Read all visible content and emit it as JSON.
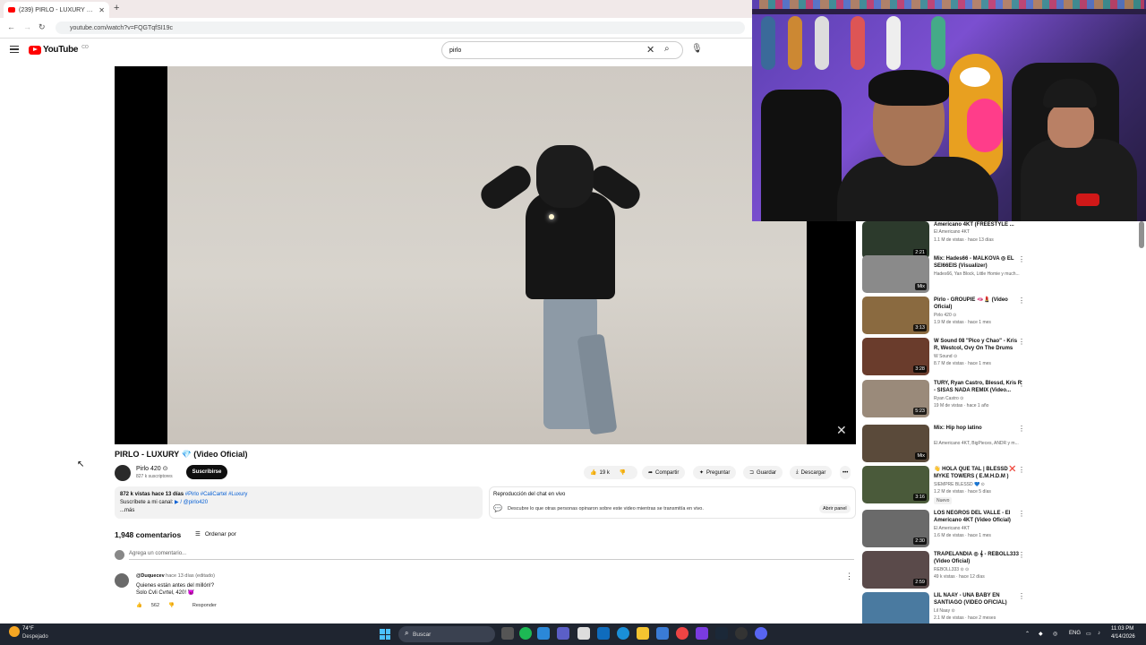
{
  "browser": {
    "tab_title": "(239) PIRLO - LUXURY 💎 (Vide",
    "tab_close": "✕",
    "new_tab": "+",
    "url": "youtube.com/watch?v=FQGTqfSI19c"
  },
  "header": {
    "logo_text": "YouTube",
    "logo_suffix": "CO",
    "search_value": "pirlo",
    "search_clear": "✕",
    "search_icon": "⌕",
    "mic_icon": "🎙"
  },
  "video": {
    "title": "PIRLO - LUXURY 💎 (Video Oficial)",
    "channel": "Pirlo 420 ⊙",
    "subs": "827 k suscriptores",
    "subscribe": "Suscribirse",
    "likes": "19 k",
    "share": "Compartir",
    "ask": "Preguntar",
    "save": "Guardar",
    "download": "Descargar",
    "more": "•••"
  },
  "description": {
    "views": "872 k vistas  hace 13 días",
    "tags": " #Pirlo #CaliCartel #Luxury",
    "line2": "Suscríbete a mi canal: ",
    "link": "▶ / @pirlo420",
    "more": "...más"
  },
  "chat": {
    "title": "Reproducción del chat en vivo",
    "desc": "Descubre lo que otras personas opinaron sobre este video mientras se transmitía en vivo.",
    "open": "Abrir panel"
  },
  "comments": {
    "count": "1,948 comentarios",
    "sort": "Ordenar por",
    "placeholder": "Agrega un comentario...",
    "first": {
      "user": "@Duquecev",
      "time": " hace 13 días (editado)",
      "line1": "Quienes están antes del millón!?",
      "line2": "Solo Cvli Cvrtel, 420! 😈",
      "likes": "562",
      "reply": "Responder"
    }
  },
  "sidebar": [
    {
      "title": "Americano 4KT (FREESTYLE ...",
      "channel": "El Americano 4KT",
      "meta": "1.1 M de vistas · hace 13 días",
      "duration": "2:21",
      "thumb": "#2c3a2c"
    },
    {
      "title": "Mix: Hades66 - MALKOVA ◎ EL SEI66EIS (Visualizer)",
      "channel": "Hades66, Yan Block, Little Homie y much...",
      "meta": "",
      "duration": "Mix",
      "thumb": "#8a8a8a"
    },
    {
      "title": "Pirlo - GROUPIE 🫦💄 (Video Oficial)",
      "channel": "Pirlo 420 ⊙",
      "meta": "1.9 M de vistas · hace 1 mes",
      "duration": "3:13",
      "thumb": "#8a6a40"
    },
    {
      "title": "W Sound 08 \"Pico y Chao\" - Kris R, Westcol, Ovy On The Drums",
      "channel": "W Sound ⊙",
      "meta": "8.7 M de vistas · hace 1 mes",
      "duration": "3:28",
      "thumb": "#6a3c2c"
    },
    {
      "title": "TURY, Ryan Castro, Blessd, Kris R - SISAS NADA REMIX (Video...",
      "channel": "Ryan Castro ⊙",
      "meta": "19 M de vistas · hace 1 año",
      "duration": "5:23",
      "thumb": "#9a8a7a"
    },
    {
      "title": "Mix: Hip hop latino",
      "channel": "El Americano 4KT, BigPieces, ANDR y m...",
      "meta": "",
      "duration": "Mix",
      "thumb": "#5a4a3a"
    },
    {
      "title": "👋 HOLA QUE TAL | BLESSD ❌ MYKE TOWERS ( E.M.H.D.M )",
      "channel": "SIEMPRE BLESSD 💙 ⊙",
      "meta": "1.2 M de vistas · hace 5 días",
      "duration": "3:16",
      "thumb": "#4a5a3a",
      "badge": "Nuevo"
    },
    {
      "title": "LOS NEGROS DEL VALLE - El Americano 4KT (Video Oficial)",
      "channel": "El Americano 4KT",
      "meta": "1.6 M de vistas · hace 1 mes",
      "duration": "2:30",
      "thumb": "#6a6a6a"
    },
    {
      "title": "TRAPELANDIA ◎ 𝄞 - REBOLL333 (Video Oficial)",
      "channel": "REBOLL333 ⊙ ⊙",
      "meta": "49 k vistas · hace 12 días",
      "duration": "2:59",
      "thumb": "#5a4a4a"
    },
    {
      "title": "LIL NAAY - UNA BABY EN SANTIAGO (VIDEO OFICIAL)",
      "channel": "Lil Naay ⊙",
      "meta": "2.1 M de vistas · hace 2 meses",
      "duration": "",
      "thumb": "#4a7aa0"
    }
  ],
  "taskbar": {
    "temp": "74°F",
    "weather": "Despejado",
    "search": "Buscar",
    "lang": "ENG",
    "time": "11:03 PM",
    "date": "4/14/2026"
  },
  "colors": {
    "accent": "#ff0000",
    "taskbar": "#1f2530",
    "webcam_bg": "#5a3fb0"
  }
}
